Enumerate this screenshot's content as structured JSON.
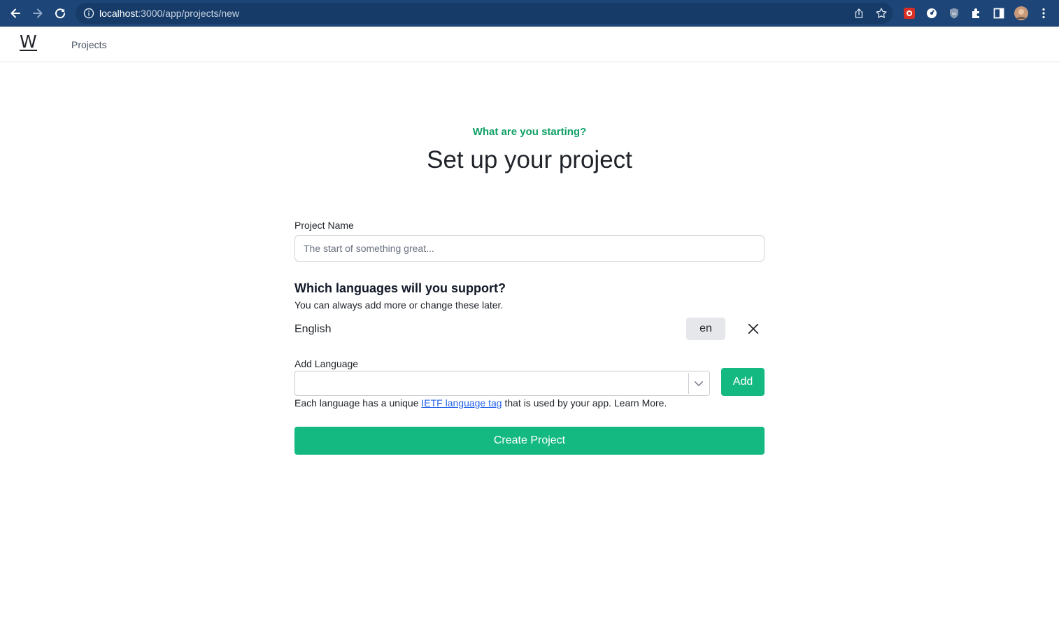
{
  "browser": {
    "url_host": "localhost",
    "url_rest": ":3000/app/projects/new",
    "icons": [
      "back-icon",
      "forward-icon",
      "reload-icon",
      "info-icon",
      "share-icon",
      "star-icon",
      "extension-red-icon",
      "extension-gauge-icon",
      "extension-shield-icon",
      "extensions-puzzle-icon",
      "side-panel-icon",
      "profile-avatar",
      "menu-dots-icon"
    ]
  },
  "header": {
    "logo": "W",
    "nav_projects": "Projects"
  },
  "main": {
    "eyebrow": "What are you starting?",
    "title": "Set up your project",
    "project_name_label": "Project Name",
    "project_name_placeholder": "The start of something great...",
    "project_name_value": "",
    "languages_title": "Which languages will you support?",
    "languages_subtitle": "You can always add more or change these later.",
    "languages": [
      {
        "name": "English",
        "code": "en"
      }
    ],
    "add_language_label": "Add Language",
    "add_language_value": "",
    "add_button": "Add",
    "help_prefix": "Each language has a unique ",
    "help_link": "IETF language tag",
    "help_suffix": " that is used by your app. Learn More.",
    "create_button": "Create Project"
  },
  "colors": {
    "accent": "#13b981",
    "eyebrow": "#10a066",
    "browser_bar": "#1d4577",
    "link": "#2563eb"
  }
}
